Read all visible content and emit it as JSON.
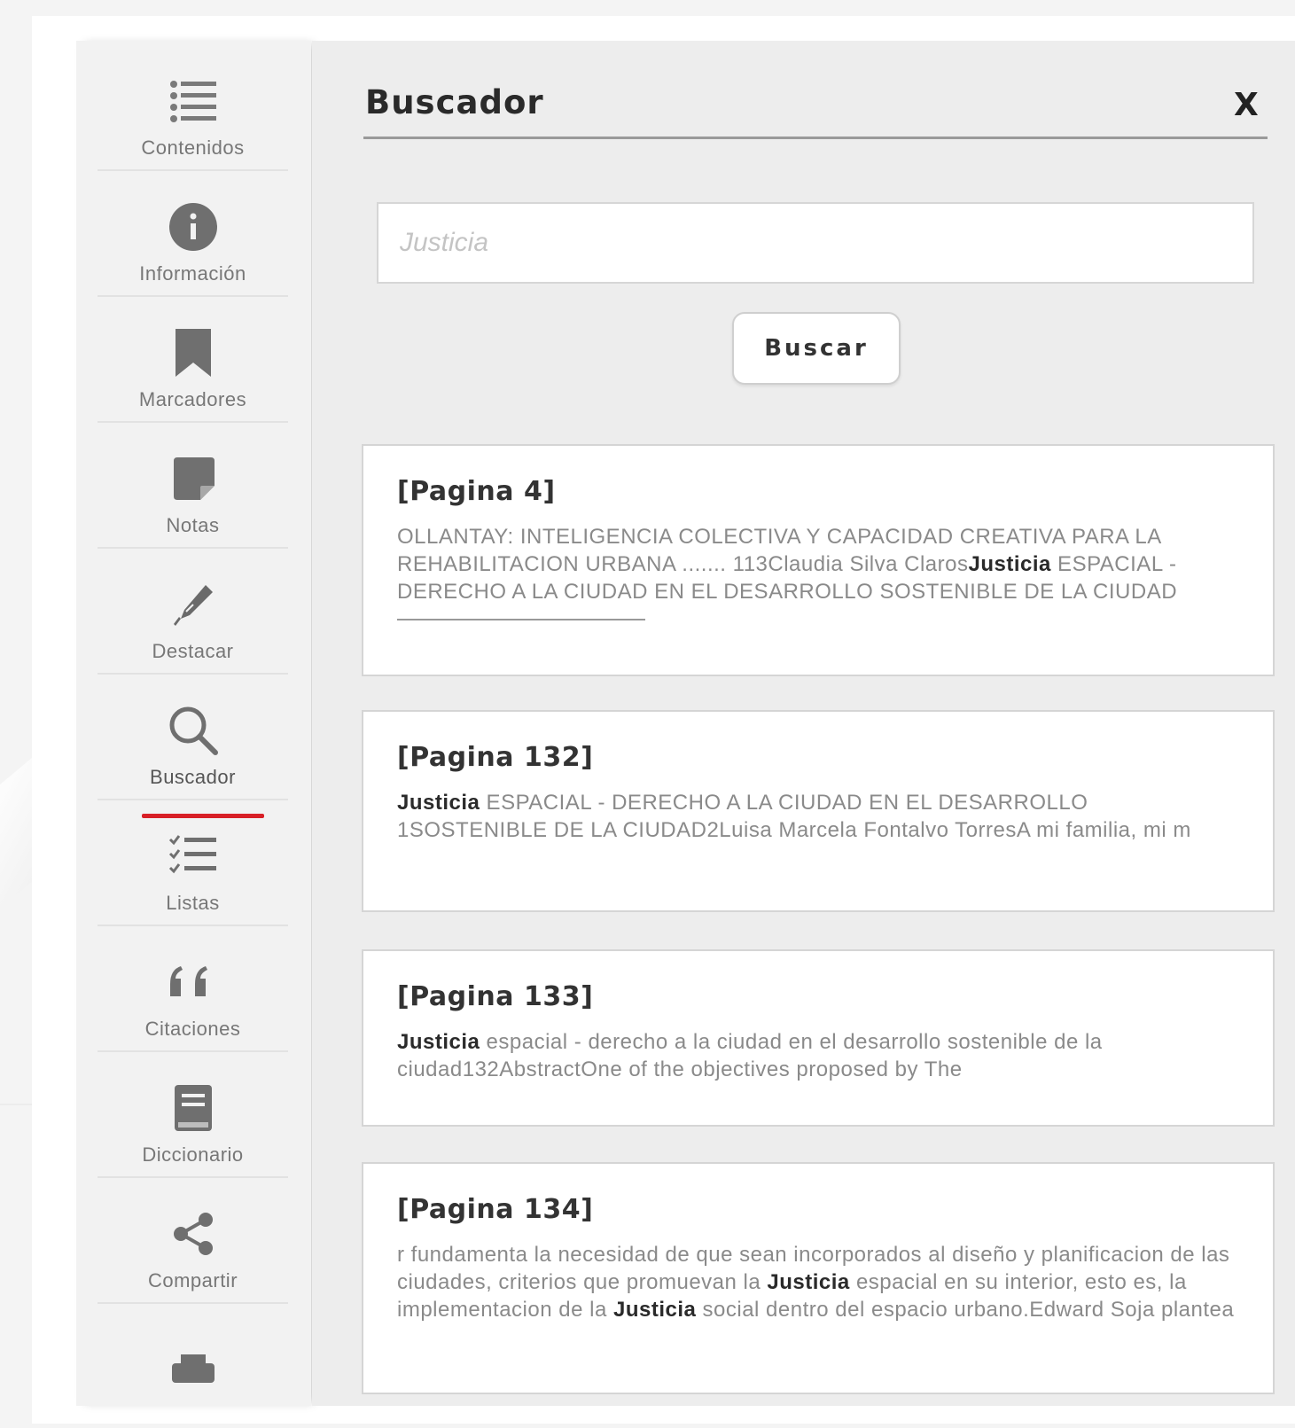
{
  "sidebar": {
    "items": [
      {
        "label": "Contenidos",
        "icon": "list-icon"
      },
      {
        "label": "Información",
        "icon": "info-icon"
      },
      {
        "label": "Marcadores",
        "icon": "bookmark-icon"
      },
      {
        "label": "Notas",
        "icon": "note-icon"
      },
      {
        "label": "Destacar",
        "icon": "highlighter-icon"
      },
      {
        "label": "Buscador",
        "icon": "search-icon",
        "active": true
      },
      {
        "label": "Listas",
        "icon": "checklist-icon"
      },
      {
        "label": "Citaciones",
        "icon": "quote-icon"
      },
      {
        "label": "Diccionario",
        "icon": "dictionary-icon"
      },
      {
        "label": "Compartir",
        "icon": "share-icon"
      },
      {
        "label": "",
        "icon": "print-icon"
      }
    ]
  },
  "panel": {
    "title": "Buscador",
    "close_label": "X",
    "search_placeholder": "Justicia",
    "search_button": "Buscar"
  },
  "results": [
    {
      "page": "[Pagina 4]",
      "segments": [
        {
          "text": "OLLANTAY: INTELIGENCIA COLECTIVA Y CAPACIDAD CREATIVA PARA LA REHABILITACION URBANA ....... 113Claudia Silva Claros",
          "bold": false
        },
        {
          "text": "Justicia",
          "bold": true
        },
        {
          "text": " ESPACIAL - DERECHO A LA CIUDAD EN EL DESARROLLO SOSTENIBLE DE LA CIUDAD",
          "bold": false
        }
      ]
    },
    {
      "page": "[Pagina 132]",
      "segments": [
        {
          "text": "Justicia",
          "bold": true
        },
        {
          "text": " ESPACIAL - DERECHO A LA CIUDAD EN EL DESARROLLO 1SOSTENIBLE DE LA CIUDAD2Luisa Marcela Fontalvo TorresA mi familia, mi m",
          "bold": false
        }
      ]
    },
    {
      "page": "[Pagina 133]",
      "segments": [
        {
          "text": "Justicia",
          "bold": true
        },
        {
          "text": " espacial - derecho a la ciudad en el desarrollo sostenible de la ciudad132AbstractOne of the objectives proposed by The",
          "bold": false
        }
      ]
    },
    {
      "page": "[Pagina 134]",
      "segments": [
        {
          "text": "r fundamenta la necesidad de que sean incorporados al diseño y planificacion de las ciudades, criterios que promuevan la ",
          "bold": false
        },
        {
          "text": "Justicia",
          "bold": true
        },
        {
          "text": " espacial en su interior, esto es, la implementacion de la ",
          "bold": false
        },
        {
          "text": "Justicia",
          "bold": true
        },
        {
          "text": " social dentro del espacio urbano.Edward Soja plantea",
          "bold": false
        }
      ]
    }
  ],
  "colors": {
    "accent": "#d81f26",
    "sidebar_bg": "#f2f2f2",
    "panel_bg": "#ededed"
  }
}
